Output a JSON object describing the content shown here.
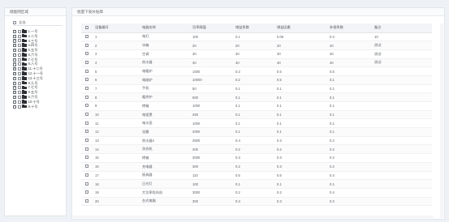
{
  "left_panel": {
    "title": "储能网区域",
    "root_label": "全选",
    "items": [
      "1.一号",
      "2.二号",
      "3.三号",
      "4.四号",
      "5.五号",
      "6.六号",
      "7.七号",
      "8.八号",
      "11.十二号",
      "12.十一号",
      "13.十三号",
      "9.九号",
      "7.七号",
      "9.五号",
      "6.六号",
      "10.十号",
      "9.十号"
    ]
  },
  "right_panel": {
    "title": "批量下发补贴率",
    "columns": [
      "",
      "设备编号",
      "电器名称",
      "功率阈值",
      "增益系数",
      "增益因素",
      "补偿系数",
      "备注"
    ],
    "rows": [
      [
        "1",
        "电灯",
        "100",
        "0.1",
        "0.05",
        "0.3",
        "10"
      ],
      [
        "2",
        "冰箱",
        "20",
        "20",
        "20",
        "20",
        "测试"
      ],
      [
        "3",
        "空调",
        "30",
        "30",
        "30",
        "30",
        "测试"
      ],
      [
        "4",
        "热水器",
        "40",
        "40",
        "40",
        "40",
        "测试"
      ],
      [
        "5",
        "电暖炉",
        "1000",
        "0.2",
        "0.5",
        "0.5",
        ""
      ],
      [
        "6",
        "电磁炉",
        "10000",
        "0.2",
        "0.5",
        "0.1",
        ""
      ],
      [
        "7",
        "手机",
        "50",
        "0.1",
        "0.1",
        "0.1",
        ""
      ],
      [
        "8",
        "暖烘炉",
        "500",
        "0.1",
        "0.1",
        "0.1",
        ""
      ],
      [
        "9",
        "烤箱",
        "1000",
        "0.1",
        "0.1",
        "0.1",
        ""
      ],
      [
        "10",
        "电饭煲",
        "250",
        "0.1",
        "0.1",
        "0.1",
        ""
      ],
      [
        "11",
        "电水壶",
        "1000",
        "0.1",
        "0.1",
        "0.1",
        ""
      ],
      [
        "12",
        "浴霸",
        "2000",
        "0.1",
        "0.1",
        "0.1",
        ""
      ],
      [
        "13",
        "热水器2",
        "2500",
        "0.4",
        "0.3",
        "0.2",
        ""
      ],
      [
        "14",
        "洗衣机",
        "200",
        "0.2",
        "0.2",
        "0.2",
        ""
      ],
      [
        "15",
        "烤箱",
        "3000",
        "0.3",
        "0.3",
        "0.2",
        ""
      ],
      [
        "16",
        "充电器",
        "300",
        "0.2",
        "0.3",
        "0.2",
        ""
      ],
      [
        "17",
        "厨具器",
        "110",
        "0.5",
        "0.6",
        "0.4",
        ""
      ],
      [
        "18",
        "日光灯",
        "100",
        "0.1",
        "0.1",
        "0.1",
        ""
      ],
      [
        "19",
        "大功率吹风机",
        "3000",
        "0.2",
        "0.2",
        "0.4",
        ""
      ],
      [
        "20",
        "台式电脑",
        "300",
        "0.3",
        "0.3",
        "0.3",
        ""
      ]
    ]
  }
}
